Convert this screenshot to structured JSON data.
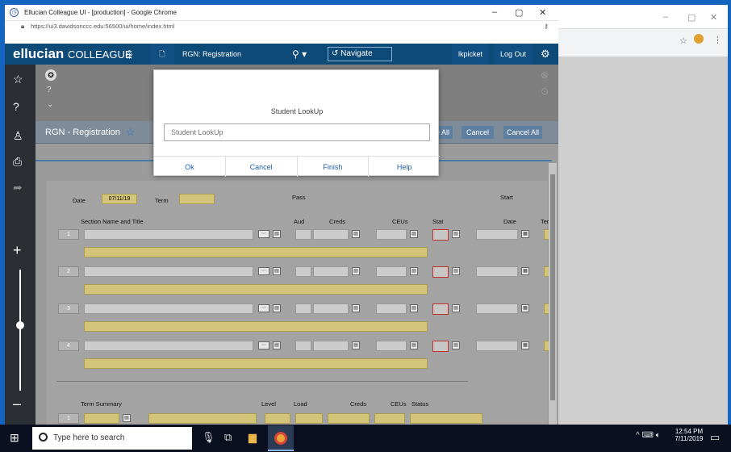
{
  "browser": {
    "tab_title": "Ellucian Colleague UI - [production] - Google Chrome",
    "url": "https://ui3.davidsonccc.edu:56500/ui/home/index.html"
  },
  "appbar": {
    "logo": "ellucian",
    "logo_sub": "COLLEAGUE",
    "form_label": "RGN: Registration",
    "navigate_label": "Navigate",
    "user": "lkpicket",
    "logout_label": "Log Out"
  },
  "form": {
    "title": "RGN - Registration",
    "actions": [
      "e All",
      "Cancel",
      "Cancel All"
    ],
    "date_label": "Date",
    "date_value": "07/11/19",
    "term_label": "Term",
    "pass_label": "Pass",
    "start_label": "Start",
    "col_headers": {
      "section": "Section Name and Title",
      "aud": "Aud",
      "creds": "Creds",
      "ceus": "CEUs",
      "stat": "Stat",
      "date": "Date",
      "ter": "Ter"
    },
    "rows": [
      "1",
      "2",
      "3",
      "4"
    ],
    "summary": {
      "term_summary": "Term Summary",
      "level": "Level",
      "load": "Load",
      "creds": "Creds",
      "ceus": "CEUs",
      "status": "Status",
      "row": "1"
    }
  },
  "dialog": {
    "title": "Student LookUp",
    "placeholder": "Student LookUp",
    "buttons": [
      "Ok",
      "Cancel",
      "Finish",
      "Help"
    ]
  },
  "taskbar": {
    "search_placeholder": "Type here to search",
    "time": "12:54 PM",
    "date": "7/11/2019"
  }
}
